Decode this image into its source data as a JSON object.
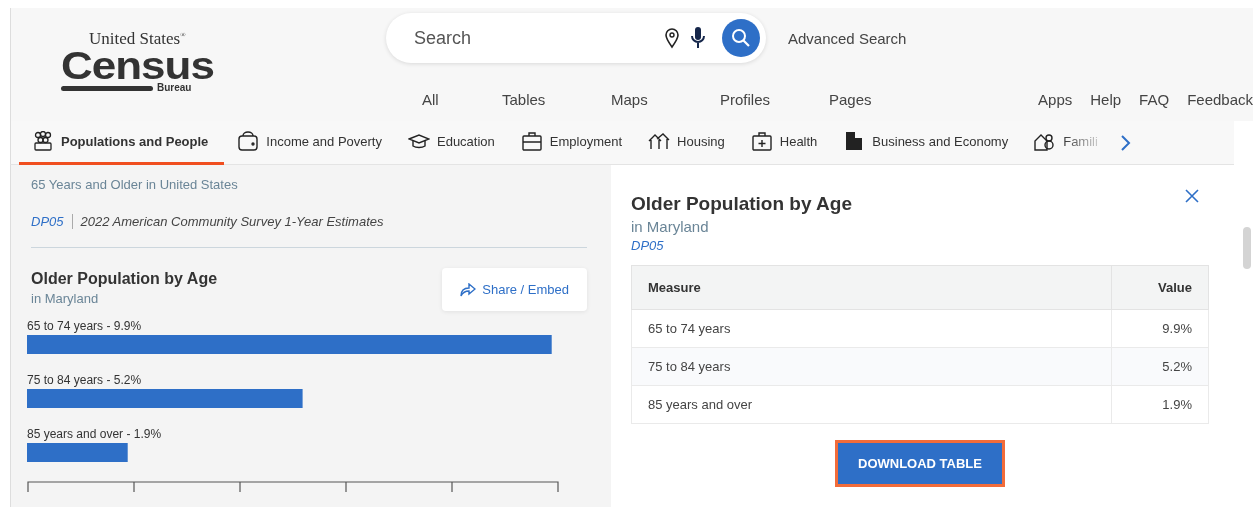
{
  "header": {
    "logo": {
      "top": "United States",
      "main": "Census",
      "bottom": "Bureau",
      "mark": "®"
    },
    "search": {
      "placeholder": "Search"
    },
    "advanced_search": "Advanced Search",
    "nav_left": [
      "All",
      "Tables",
      "Maps",
      "Profiles",
      "Pages"
    ],
    "nav_right": [
      "Apps",
      "Help",
      "FAQ",
      "Feedback"
    ]
  },
  "topics": [
    {
      "label": "Populations and People",
      "kind": "people",
      "selected": true
    },
    {
      "label": "Income and Poverty",
      "kind": "wallet",
      "selected": false
    },
    {
      "label": "Education",
      "kind": "cap",
      "selected": false
    },
    {
      "label": "Employment",
      "kind": "briefcase",
      "selected": false
    },
    {
      "label": "Housing",
      "kind": "houses",
      "selected": false
    },
    {
      "label": "Health",
      "kind": "kit",
      "selected": false
    },
    {
      "label": "Business and Economy",
      "kind": "building",
      "selected": false
    },
    {
      "label": "Famili",
      "kind": "family",
      "selected": false
    }
  ],
  "left": {
    "subtitle": "65 Years and Older in United States",
    "code": "DP05",
    "source": "2022 American Community Survey 1-Year Estimates",
    "chart_title": "Older Population by Age",
    "chart_subtitle": "in Maryland",
    "share": "Share / Embed",
    "bar_label_separator": "-",
    "chart_data": {
      "type": "bar",
      "orientation": "horizontal",
      "categories": [
        "65 to 74 years",
        "75 to 84 years",
        "85 years and over"
      ],
      "values": [
        9.9,
        5.2,
        1.9
      ],
      "value_labels": [
        "9.9%",
        "5.2%",
        "1.9%"
      ],
      "xlim": [
        0,
        10
      ]
    }
  },
  "panel": {
    "title": "Older Population by Age",
    "subtitle": "in Maryland",
    "code": "DP05",
    "table": {
      "columns": [
        "Measure",
        "Value"
      ],
      "rows": [
        [
          "65 to 74 years",
          "9.9%"
        ],
        [
          "75 to 84 years",
          "5.2%"
        ],
        [
          "85 years and over",
          "1.9%"
        ]
      ]
    },
    "button": "DOWNLOAD TABLE"
  }
}
